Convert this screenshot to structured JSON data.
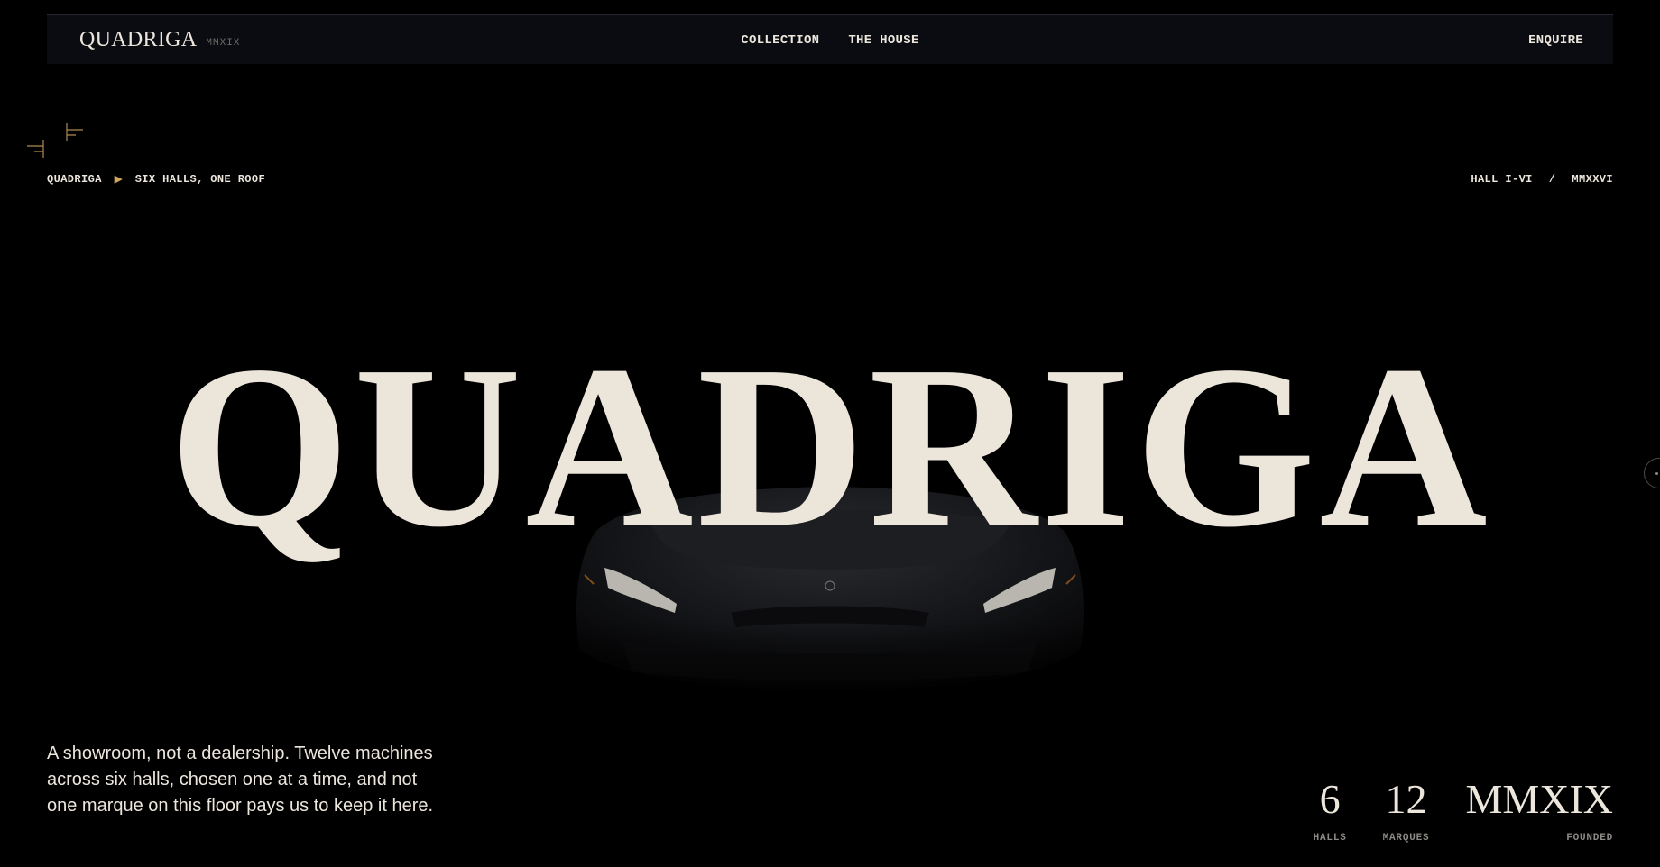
{
  "brand": {
    "name": "QUADRIGA",
    "year": "MMXIX"
  },
  "nav": {
    "links": [
      {
        "label": "COLLECTION"
      },
      {
        "label": "THE HOUSE"
      }
    ],
    "enquire_label": "ENQUIRE"
  },
  "breadcrumb": {
    "root": "QUADRIGA",
    "current": "SIX HALLS, ONE ROOF"
  },
  "meta": {
    "halls": "HALL I-VI",
    "separator": "/",
    "year": "MMXXVI"
  },
  "hero": {
    "title": "QUADRIGA"
  },
  "intro": {
    "text": "A showroom, not a dealership. Twelve machines across six halls, chosen one at a time, and not one marque on this floor pays us to keep it here."
  },
  "stats": [
    {
      "value": "6",
      "label": "HALLS"
    },
    {
      "value": "12",
      "label": "MARQUES"
    },
    {
      "value": "MMXIX",
      "label": "FOUNDED"
    }
  ],
  "colors": {
    "background": "#000000",
    "nav_background": "#0a0c11",
    "text": "#ece6dc",
    "accent": "#d4a55a",
    "muted": "#8d8a85"
  }
}
